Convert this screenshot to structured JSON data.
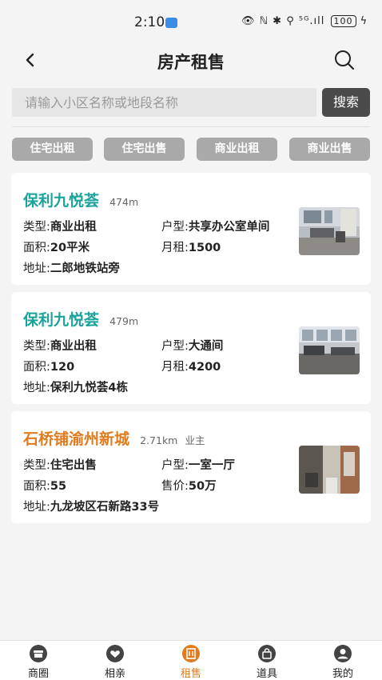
{
  "status_bar": {
    "time": "2:10",
    "icons": "👁 ℕ ✱ ⚲ ⁵ᴳ.ıll",
    "battery": "100",
    "charging": "ϟ"
  },
  "nav": {
    "title": "房产租售"
  },
  "search": {
    "placeholder": "请输入小区名称或地段名称",
    "value": "",
    "button_label": "搜索"
  },
  "filters": [
    "住宅出租",
    "住宅出售",
    "商业出租",
    "商业出售"
  ],
  "listings": [
    {
      "title": "保利九悦荟",
      "distance": "474m",
      "owner": "",
      "type_label": "类型:",
      "type_value": "商业出租",
      "layout_label": "户型:",
      "layout_value": "共享办公室单间",
      "area_label": "面积:",
      "area_value": "20平米",
      "price_label": "月租:",
      "price_value": "1500",
      "address_label": "地址:",
      "address_value": "二郎地铁站旁"
    },
    {
      "title": "保利九悦荟",
      "distance": "479m",
      "owner": "",
      "type_label": "类型:",
      "type_value": "商业出租",
      "layout_label": "户型:",
      "layout_value": "大通间",
      "area_label": "面积:",
      "area_value": "120",
      "price_label": "月租:",
      "price_value": "4200",
      "address_label": "地址:",
      "address_value": "保利九悦荟4栋"
    },
    {
      "title": "石桥铺渝州新城",
      "distance": "2.71km",
      "owner": "业主",
      "type_label": "类型:",
      "type_value": "住宅出售",
      "layout_label": "户型:",
      "layout_value": "一室一厅",
      "area_label": "面积:",
      "area_value": "55",
      "price_label": "售价:",
      "price_value": "50万",
      "address_label": "地址:",
      "address_value": "九龙坡区石新路33号"
    }
  ],
  "tabs": [
    {
      "label": "商圈",
      "icon": "shop-icon"
    },
    {
      "label": "相亲",
      "icon": "heart-icon"
    },
    {
      "label": "租售",
      "icon": "building-icon",
      "active": true
    },
    {
      "label": "道具",
      "icon": "bag-icon"
    },
    {
      "label": "我的",
      "icon": "user-icon"
    }
  ],
  "colors": {
    "accent": "#e07b1f",
    "teal_title": "#1aa39a",
    "chip_bg": "#a9a9a9",
    "search_button_bg": "#4a4a4a"
  }
}
